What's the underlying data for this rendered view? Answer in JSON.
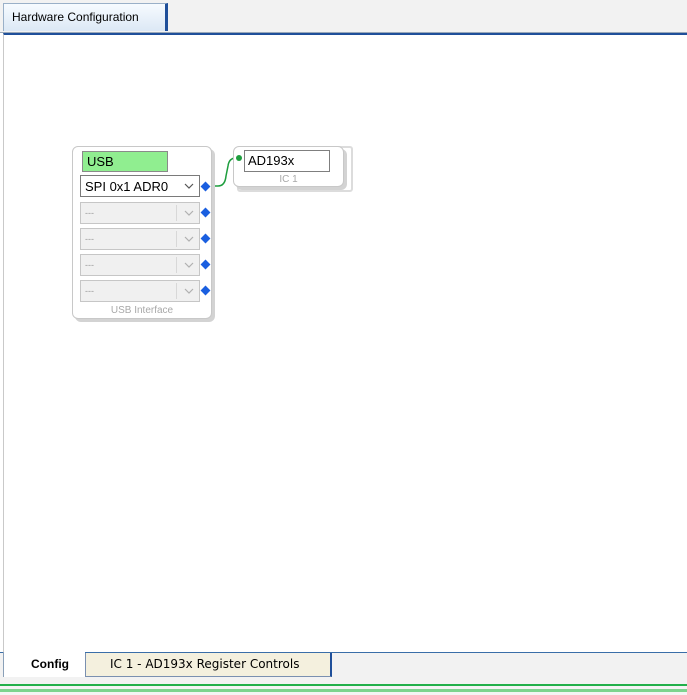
{
  "top_tab": {
    "label": "Hardware Configuration"
  },
  "usb_block": {
    "name": "USB",
    "caption": "USB Interface",
    "channels": [
      {
        "value": "SPI 0x1 ADR0",
        "enabled": true
      },
      {
        "value": "---",
        "enabled": false
      },
      {
        "value": "---",
        "enabled": false
      },
      {
        "value": "---",
        "enabled": false
      },
      {
        "value": "---",
        "enabled": false
      }
    ]
  },
  "ic_block": {
    "name": "AD193x",
    "caption": "IC 1"
  },
  "bottom_tabs": [
    {
      "label": "Config",
      "active": true
    },
    {
      "label": "IC 1 - AD193x Register Controls",
      "active": false
    }
  ],
  "colors": {
    "usb_name_bg": "#90ee90",
    "pin": "#1a5fe0",
    "wire": "#1e9e3e",
    "accent": "#1f4f9a"
  },
  "icons": {
    "dropdown": "chevron-down-icon",
    "output_pin": "diamond-pin-icon",
    "input_pin": "dot-pin-icon"
  }
}
